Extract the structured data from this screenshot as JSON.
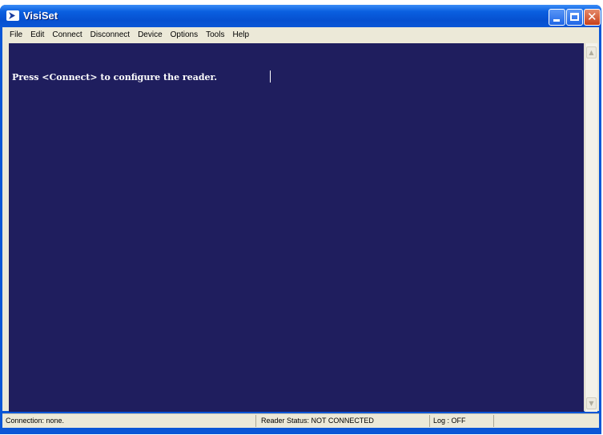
{
  "window": {
    "title": "VisiSet",
    "controls": {
      "minimize": "minimize",
      "maximize": "maximize",
      "close": "✕"
    }
  },
  "menu": [
    "File",
    "Edit",
    "Connect",
    "Disconnect",
    "Device",
    "Options",
    "Tools",
    "Help"
  ],
  "terminal": {
    "text": "Press <Connect> to configure the reader."
  },
  "status": {
    "connection": "Connection: none.",
    "reader_status": "Reader Status: NOT CONNECTED",
    "log": "Log : OFF"
  },
  "icons": {
    "app": "app-logo-icon",
    "scroll_up": "scroll-up-arrow-icon",
    "scroll_down": "scroll-down-arrow-icon"
  }
}
